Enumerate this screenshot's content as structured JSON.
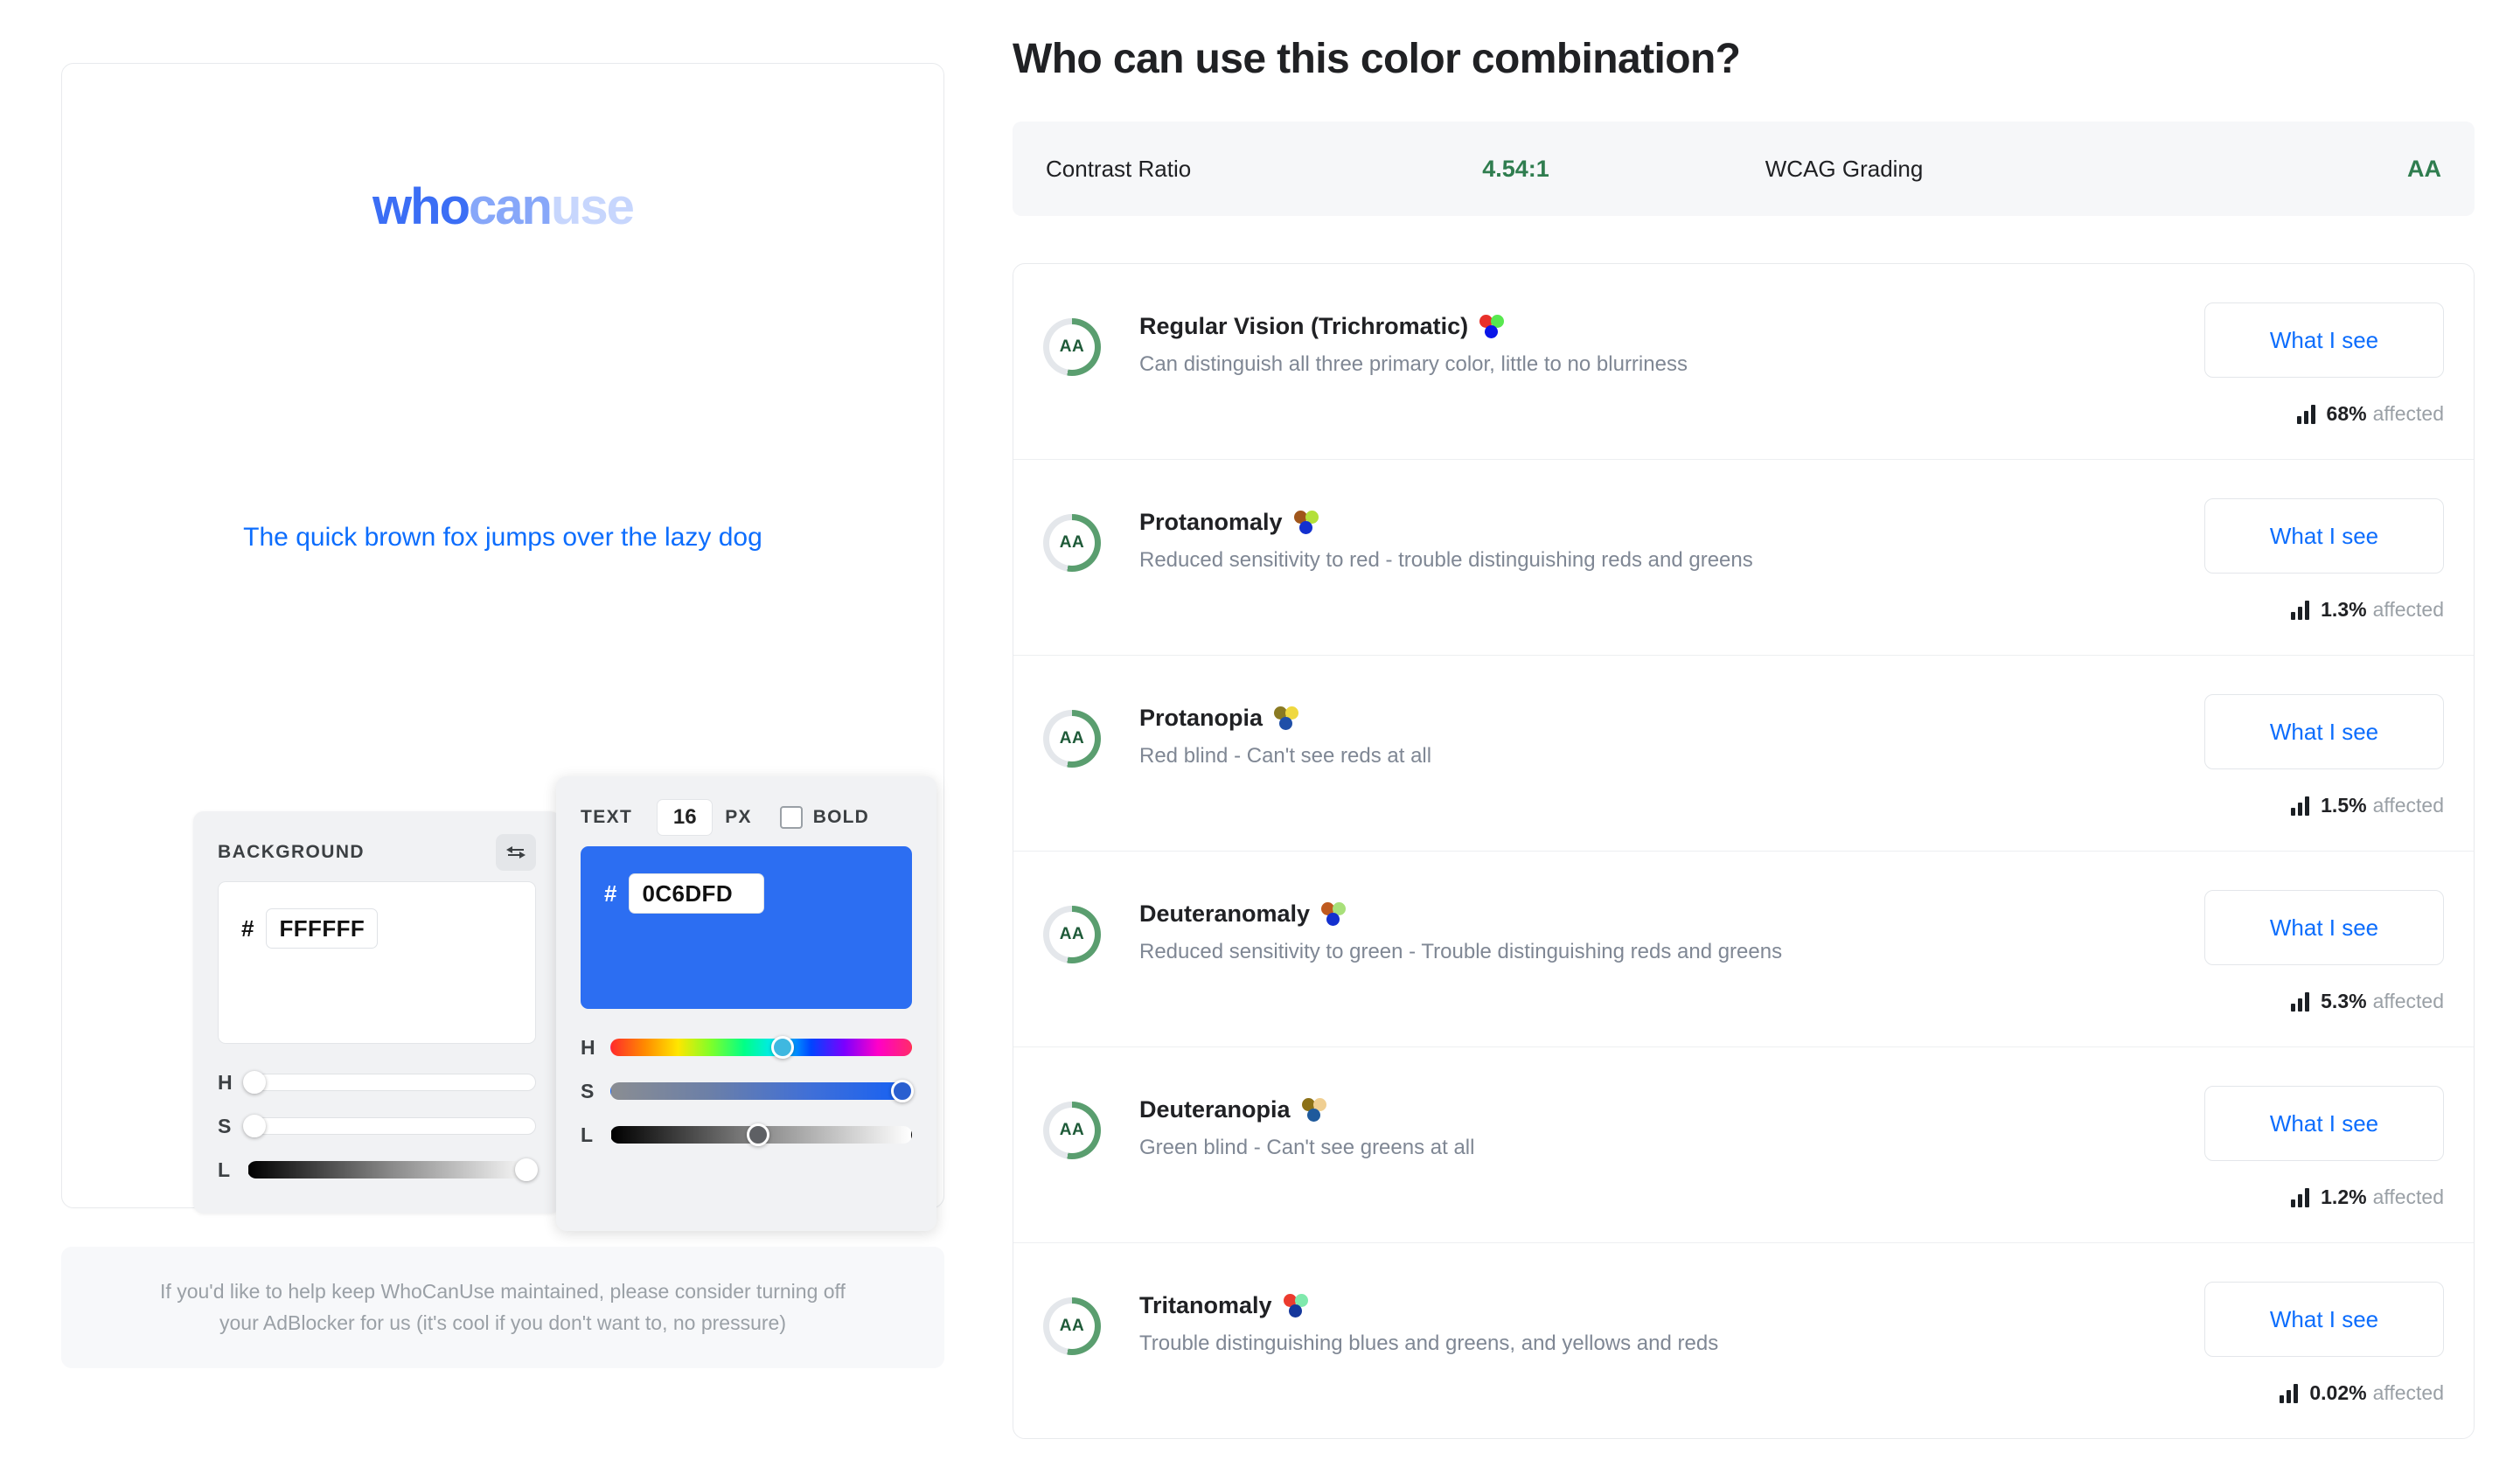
{
  "logo": {
    "part1": "who",
    "part2": "can",
    "part3": "use",
    "color1": "#3b6ef5",
    "color2": "#87a7f9",
    "color3": "#c7d6fd"
  },
  "preview": {
    "sample_text": "The quick brown fox jumps over the lazy dog"
  },
  "background_panel": {
    "title": "BACKGROUND",
    "hash": "#",
    "hex": "FFFFFF",
    "swap_icon": "swap-horizontal-icon",
    "sliders": [
      {
        "label": "H",
        "pos_pct": 2
      },
      {
        "label": "S",
        "pos_pct": 2
      },
      {
        "label": "L",
        "pos_pct": 97
      }
    ]
  },
  "text_panel": {
    "title": "TEXT",
    "font_size": "16",
    "px_label": "PX",
    "bold_label": "BOLD",
    "bold_checked": false,
    "hash": "#",
    "hex": "0C6DFD",
    "swatch_color": "#2c6ef2",
    "sliders": [
      {
        "label": "H",
        "pos_pct": 57
      },
      {
        "label": "S",
        "pos_pct": 97
      },
      {
        "label": "L",
        "pos_pct": 49
      }
    ]
  },
  "ad_notice": "If you'd like to help keep WhoCanUse maintained, please consider turning off your AdBlocker for us (it's cool if you don't want to, no pressure)",
  "header": {
    "title": "Who can use this color combination?"
  },
  "contrast": {
    "ratio_label": "Contrast Ratio",
    "ratio_value": "4.54:1",
    "grading_label": "WCAG Grading",
    "grading_value": "AA",
    "accent_green": "#2f7d4f"
  },
  "results": {
    "what_i_see_label": "What I see",
    "affected_suffix": "affected",
    "rows": [
      {
        "badge": "AA",
        "name": "Regular Vision (Trichromatic)",
        "description": "Can distinguish all three primary color, little to no blurriness",
        "affected_pct": "68%",
        "dots": [
          "#e8302a",
          "#58e84f",
          "#0a16e8"
        ]
      },
      {
        "badge": "AA",
        "name": "Protanomaly",
        "description": "Reduced sensitivity to red - trouble distinguishing reds and greens",
        "affected_pct": "1.3%",
        "dots": [
          "#a0561b",
          "#b3e03a",
          "#1330cf"
        ]
      },
      {
        "badge": "AA",
        "name": "Protanopia",
        "description": "Red blind - Can't see reds at all",
        "affected_pct": "1.5%",
        "dots": [
          "#8a7a22",
          "#efd83f",
          "#1f4fa8"
        ]
      },
      {
        "badge": "AA",
        "name": "Deuteranomaly",
        "description": "Reduced sensitivity to green - Trouble distinguishing reds and greens",
        "affected_pct": "5.3%",
        "dots": [
          "#bf5a1f",
          "#a8e07a",
          "#1330cf"
        ]
      },
      {
        "badge": "AA",
        "name": "Deuteranopia",
        "description": "Green blind - Can't see greens at all",
        "affected_pct": "1.2%",
        "dots": [
          "#8c7118",
          "#f0cf92",
          "#1f5a9c"
        ]
      },
      {
        "badge": "AA",
        "name": "Tritanomaly",
        "description": "Trouble distinguishing blues and greens, and yellows and reds",
        "affected_pct": "0.02%",
        "dots": [
          "#ec3b2e",
          "#7fe9ac",
          "#15379c"
        ]
      }
    ]
  }
}
